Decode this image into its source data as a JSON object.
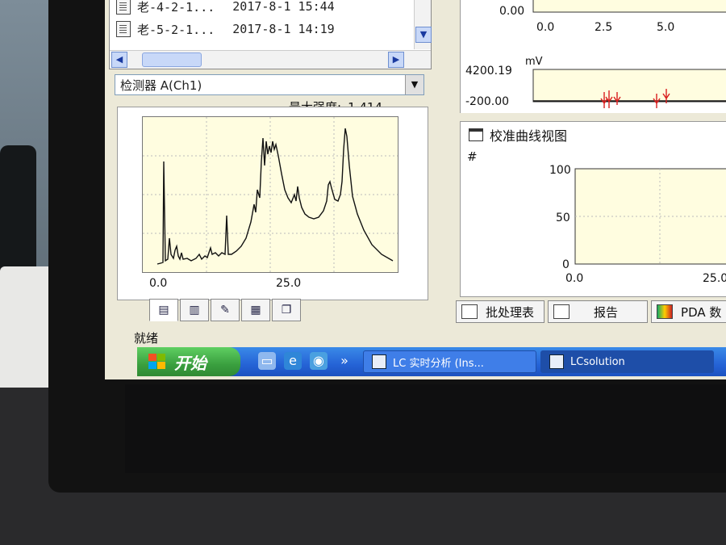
{
  "files": [
    {
      "name": "老-4-2-1...",
      "date": "2017-8-1 15:44"
    },
    {
      "name": "老-5-2-1...",
      "date": "2017-8-1 14:19"
    }
  ],
  "detector": {
    "label": "检测器 A(Ch1)"
  },
  "intensity": {
    "label": "最大强度:",
    "value": "1,414"
  },
  "chromatogram": {
    "x_ticks": [
      "0.0",
      "25.0"
    ]
  },
  "right_top": {
    "upper_ticks": [
      "0.0",
      "2.5",
      "5.0"
    ],
    "upper_y_label": "0.00",
    "unit": "mV",
    "lower_max": "4200.19",
    "lower_min": "-200.00"
  },
  "calibration": {
    "title": "校准曲线视图",
    "axis_marker": "#",
    "y_ticks": [
      "100",
      "50",
      "0"
    ],
    "x_ticks": [
      "0.0",
      "25.0"
    ]
  },
  "right_tabs": [
    "批处理表",
    "报告",
    "PDA 数"
  ],
  "status": "就绪",
  "taskbar": {
    "start_label": "开始",
    "apps": [
      "LC 实时分析 (Ins...",
      "LCsolution"
    ]
  },
  "colors": {
    "plot_bg": "#fffde0",
    "trace": "#111111",
    "marker": "#d81e1e"
  }
}
